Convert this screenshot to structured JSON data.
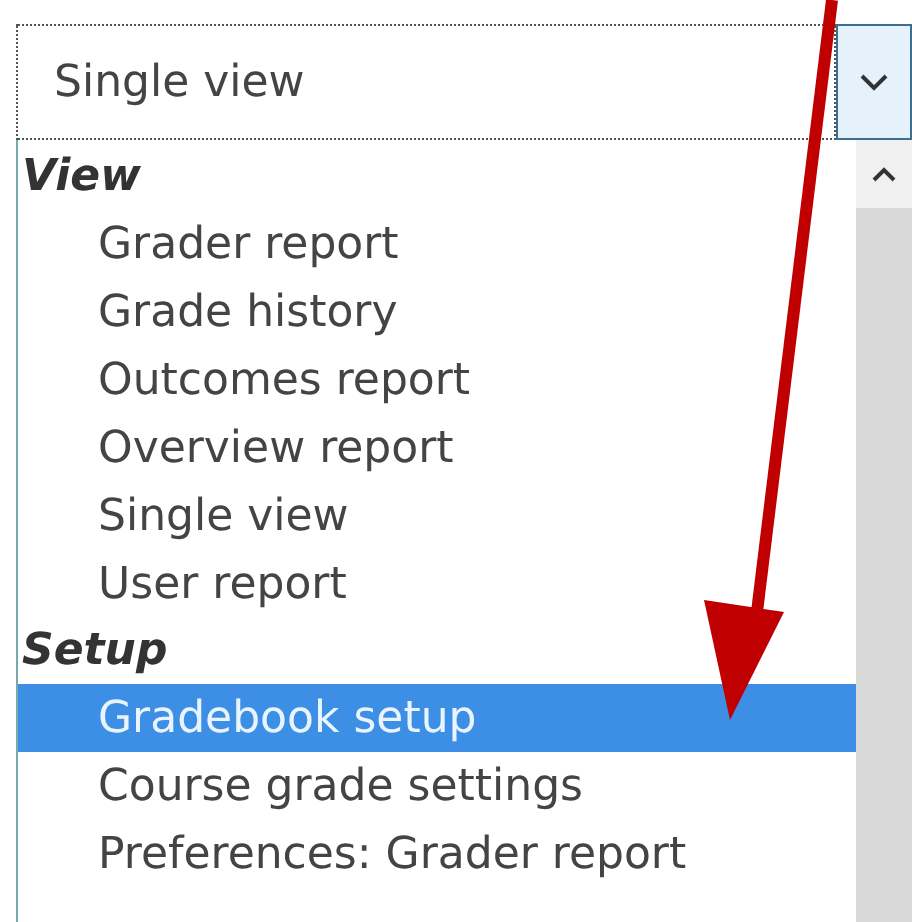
{
  "select": {
    "value": "Single view"
  },
  "groups": [
    {
      "label": "View",
      "items": [
        {
          "label": "Grader report",
          "selected": false
        },
        {
          "label": "Grade history",
          "selected": false
        },
        {
          "label": "Outcomes report",
          "selected": false
        },
        {
          "label": "Overview report",
          "selected": false
        },
        {
          "label": "Single view",
          "selected": false
        },
        {
          "label": "User report",
          "selected": false
        }
      ]
    },
    {
      "label": "Setup",
      "items": [
        {
          "label": "Gradebook setup",
          "selected": true
        },
        {
          "label": "Course grade settings",
          "selected": false
        },
        {
          "label": "Preferences: Grader report",
          "selected": false
        }
      ]
    }
  ]
}
